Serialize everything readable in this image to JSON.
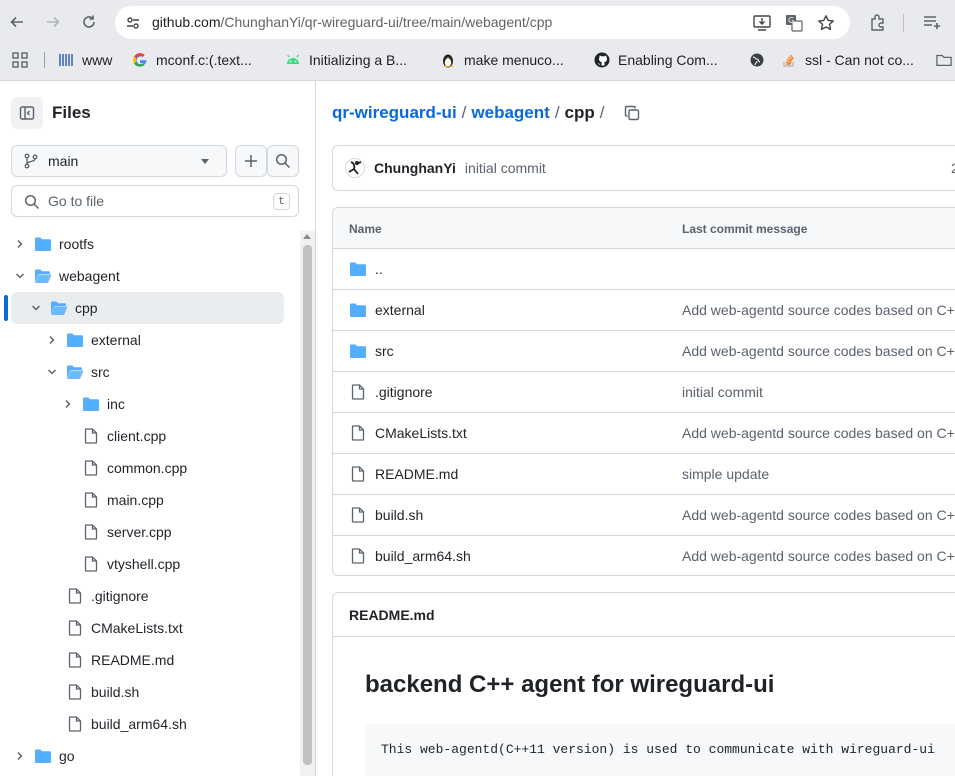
{
  "browser": {
    "url_host": "github.com",
    "url_path": "/ChunghanYi/qr-wireguard-ui/tree/main/webagent/cpp",
    "bookmarks": [
      {
        "label": "www",
        "icon": "sourceforge-icon"
      },
      {
        "label": "mconf.c:(.text...",
        "icon": "google-icon"
      },
      {
        "label": "Initializing a B...",
        "icon": "android-icon"
      },
      {
        "label": "make menuco...",
        "icon": "tux-icon"
      },
      {
        "label": "Enabling Com...",
        "icon": "github-icon"
      },
      {
        "label": "",
        "icon": "globe-icon"
      },
      {
        "label": "ssl - Can not co...",
        "icon": "stackoverflow-icon"
      }
    ]
  },
  "sidebar": {
    "title": "Files",
    "branch": "main",
    "goto_placeholder": "Go to file",
    "goto_shortcut": "t",
    "tree": [
      {
        "label": "rootfs",
        "type": "folder",
        "expanded": false
      },
      {
        "label": "webagent",
        "type": "folder",
        "expanded": true
      },
      {
        "label": "cpp",
        "type": "folder",
        "expanded": true,
        "selected": true
      },
      {
        "label": "external",
        "type": "folder",
        "expanded": false
      },
      {
        "label": "src",
        "type": "folder",
        "expanded": true
      },
      {
        "label": "inc",
        "type": "folder",
        "expanded": false
      },
      {
        "label": "client.cpp",
        "type": "file"
      },
      {
        "label": "common.cpp",
        "type": "file"
      },
      {
        "label": "main.cpp",
        "type": "file"
      },
      {
        "label": "server.cpp",
        "type": "file"
      },
      {
        "label": "vtyshell.cpp",
        "type": "file"
      },
      {
        "label": ".gitignore",
        "type": "file"
      },
      {
        "label": "CMakeLists.txt",
        "type": "file"
      },
      {
        "label": "README.md",
        "type": "file"
      },
      {
        "label": "build.sh",
        "type": "file"
      },
      {
        "label": "build_arm64.sh",
        "type": "file"
      },
      {
        "label": "go",
        "type": "folder",
        "expanded": false
      }
    ]
  },
  "main": {
    "breadcrumb": {
      "repo": "qr-wireguard-ui",
      "dir": "webagent",
      "current": "cpp",
      "separator": "/"
    },
    "latest_commit": {
      "author": "ChunghanYi",
      "message": "initial commit",
      "hash_prefix": "2"
    },
    "table": {
      "col_name": "Name",
      "col_message": "Last commit message",
      "rows": [
        {
          "name": "..",
          "type": "folder",
          "message": ""
        },
        {
          "name": "external",
          "type": "folder",
          "message": "Add web-agentd source codes based on C++"
        },
        {
          "name": "src",
          "type": "folder",
          "message": "Add web-agentd source codes based on C++"
        },
        {
          "name": ".gitignore",
          "type": "file",
          "message": "initial commit"
        },
        {
          "name": "CMakeLists.txt",
          "type": "file",
          "message": "Add web-agentd source codes based on C++"
        },
        {
          "name": "README.md",
          "type": "file",
          "message": "simple update"
        },
        {
          "name": "build.sh",
          "type": "file",
          "message": "Add web-agentd source codes based on C++"
        },
        {
          "name": "build_arm64.sh",
          "type": "file",
          "message": "Add web-agentd source codes based on C++"
        }
      ]
    },
    "readme": {
      "filename": "README.md",
      "heading": "backend C++ agent for wireguard-ui",
      "code": "This web-agentd(C++11 version) is used to communicate with wireguard-ui"
    }
  },
  "colors": {
    "link": "#0969da",
    "folder": "#54aeff",
    "border": "#d0d7de",
    "muted": "#59636e"
  }
}
